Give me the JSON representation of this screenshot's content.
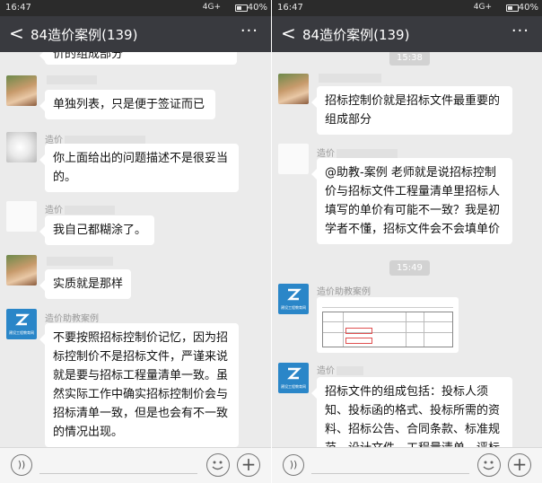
{
  "left": {
    "status": {
      "time": "16:47",
      "net": "4G+",
      "battery": "40%"
    },
    "header": {
      "back": "<",
      "title": "84造价案例(139)",
      "more": "···"
    },
    "top_fragment": "价的组成部分",
    "messages": [
      {
        "sender": "",
        "text": "单独列表，只是便于签证而已"
      },
      {
        "sender": "造价",
        "text": "你上面给出的问题描述不是很妥当的。"
      },
      {
        "sender": "造价",
        "text": "我自己都糊涂了。"
      },
      {
        "sender": "",
        "text": "实质就是那样"
      },
      {
        "sender": "造价助教案例",
        "text": "不要按照招标控制价记忆，因为招标控制价不是招标文件，严谨来说就是要与招标工程量清单一致。虽然实际工作中确实招标控制价会与招标清单一致，但是也会有不一致的情况出现。"
      }
    ]
  },
  "right": {
    "status": {
      "time": "16:47",
      "net": "4G+",
      "battery": "40%"
    },
    "header": {
      "back": "<",
      "title": "84造价案例(139)",
      "more": "···"
    },
    "timestamps": [
      "15:38",
      "15:49"
    ],
    "messages": [
      {
        "sender": "",
        "text": "招标控制价就是招标文件最重要的组成部分"
      },
      {
        "sender": "造价",
        "text": "@助教-案例  老师就是说招标控制价与招标文件工程量清单里招标人填写的单价有可能不一致？我是初学者不懂，招标文件会不会填单价"
      },
      {
        "sender": "造价助教案例",
        "text": ""
      },
      {
        "sender": "造价",
        "text": "招标文件的组成包括：投标人须知、投标函的格式、投标所需的资料、招标公告、合同条款、标准规范、设计文件、工程量清单、评标方法等"
      }
    ]
  },
  "brand_caption": "建设工程教育网",
  "icons": {
    "back": "chevron-left-icon",
    "more": "more-dots-icon",
    "voice": "voice-icon",
    "emoji": "emoji-icon",
    "plus": "plus-icon"
  },
  "colors": {
    "title_bar": "#393a3f",
    "status_bar": "#2b2b2b",
    "chat_bg": "#ebebeb",
    "bubble": "#ffffff",
    "brand_avatar": "#2a86c8"
  }
}
